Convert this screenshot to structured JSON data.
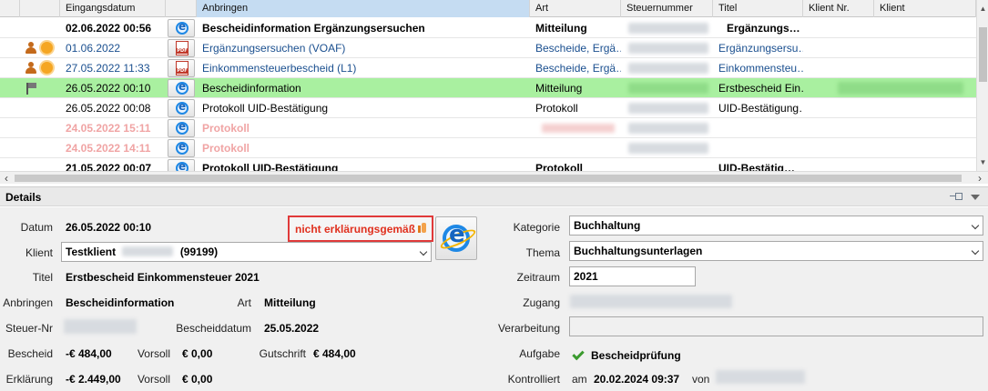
{
  "grid": {
    "headers": [
      "",
      "",
      "Eingangsdatum",
      "",
      "Anbringen",
      "Art",
      "Steuernummer",
      "Titel",
      "Klient Nr.",
      "Klient"
    ],
    "rows": [
      {
        "date": "02.06.2022 00:56",
        "doc": "ie",
        "anbringen": "Bescheidinformation Ergänzungsersuchen",
        "art": "Mitteilung",
        "titel": "Ergänzungs…",
        "style": "bold"
      },
      {
        "date": "01.06.2022",
        "doc": "pdf",
        "anbringen": "Ergänzungsersuchen (VOAF)",
        "art": "Bescheide, Ergä…",
        "titel": "Ergänzungsersu…",
        "style": "link",
        "icons": [
          "person-icon",
          "sun-icon"
        ]
      },
      {
        "date": "27.05.2022 11:33",
        "doc": "pdf",
        "anbringen": "Einkommensteuerbescheid (L1)",
        "art": "Bescheide, Ergä…",
        "titel": "Einkommensteu…",
        "style": "link",
        "icons": [
          "person-icon",
          "sun-icon"
        ]
      },
      {
        "date": "26.05.2022 00:10",
        "doc": "ie",
        "anbringen": "Bescheidinformation",
        "art": "Mitteilung",
        "titel": "Erstbescheid Ein…",
        "style": "selected",
        "icons": [
          "flag-icon"
        ]
      },
      {
        "date": "26.05.2022 00:08",
        "doc": "ie",
        "anbringen": "Protokoll UID-Bestätigung",
        "art": "Protokoll",
        "titel": "UID-Bestätigung…",
        "style": "normal"
      },
      {
        "date": "24.05.2022 15:11",
        "doc": "ie",
        "anbringen": "Protokoll",
        "art": "",
        "titel": "",
        "style": "faded"
      },
      {
        "date": "24.05.2022 14:11",
        "doc": "ie",
        "anbringen": "Protokoll",
        "art": "",
        "titel": "",
        "style": "faded"
      },
      {
        "date": "21.05.2022 00:07",
        "doc": "ie",
        "anbringen": "Protokoll UID-Bestätigung",
        "art": "Protokoll",
        "titel": "UID-Bestätig…",
        "style": "bold"
      }
    ]
  },
  "details": {
    "section_title": "Details",
    "datum_label": "Datum",
    "datum_value": "26.05.2022 00:10",
    "status_text": "nicht erklärungsgemäß",
    "klient_label": "Klient",
    "klient_name": "Testklient",
    "klient_nr": "(99199)",
    "titel_label": "Titel",
    "titel_value": "Erstbescheid Einkommensteuer 2021",
    "anbringen_label": "Anbringen",
    "anbringen_value": "Bescheidinformation",
    "art_label": "Art",
    "art_value": "Mitteilung",
    "steuernr_label": "Steuer-Nr",
    "bescheiddatum_label": "Bescheiddatum",
    "bescheiddatum_value": "25.05.2022",
    "bescheid_label": "Bescheid",
    "bescheid_value": "-€ 484,00",
    "vorsoll_label": "Vorsoll",
    "vorsoll1_value": "€ 0,00",
    "gutschrift_label": "Gutschrift",
    "gutschrift_value": "€ 484,00",
    "erklaerung_label": "Erklärung",
    "erklaerung_value": "-€ 2.449,00",
    "vorsoll2_value": "€ 0,00",
    "kategorie_label": "Kategorie",
    "kategorie_value": "Buchhaltung",
    "thema_label": "Thema",
    "thema_value": "Buchhaltungsunterlagen",
    "zeitraum_label": "Zeitraum",
    "zeitraum_value": "2021",
    "zugang_label": "Zugang",
    "verarbeitung_label": "Verarbeitung",
    "aufgabe_label": "Aufgabe",
    "aufgabe_value": "Bescheidprüfung",
    "kontrolliert_label": "Kontrolliert",
    "am_label": "am",
    "kontrolliert_date": "20.02.2024 09:37",
    "von_label": "von"
  },
  "colors": {
    "selected_row": "#a9f0a0",
    "status_red": "#e0301e",
    "link_blue": "#1a4f8f",
    "faded_pink": "#f0a4a4"
  }
}
